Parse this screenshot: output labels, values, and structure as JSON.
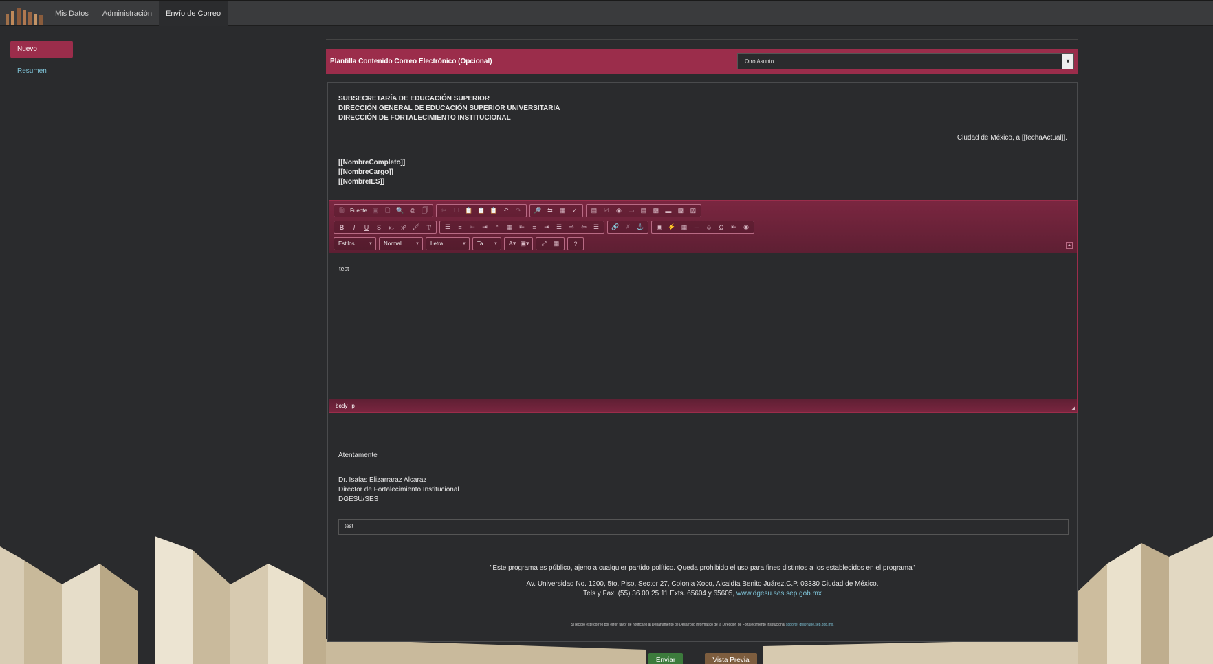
{
  "nav": {
    "items": [
      {
        "label": "Mis Datos"
      },
      {
        "label": "Administración"
      },
      {
        "label": "Envío de Correo"
      }
    ]
  },
  "sidebar": {
    "new_label": "Nuevo",
    "summary_label": "Resumen"
  },
  "template_bar": {
    "label": "Plantilla Contenido Correo Electrónico (Opcional)",
    "selected": "Otro Asunto"
  },
  "letter": {
    "header_lines": [
      "SUBSECRETARÍA DE EDUCACIÓN SUPERIOR",
      "DIRECCIÓN GENERAL DE EDUCACIÓN SUPERIOR UNIVERSITARIA",
      "DIRECCIÓN DE FORTALECIMIENTO INSTITUCIONAL"
    ],
    "date_line": "Ciudad de México, a [[fechaActual]].",
    "recipient_lines": [
      "[[NombreCompleto]]",
      "[[NombreCargo]]",
      "[[NombreIES]]"
    ],
    "closing": "Atentamente",
    "signature_lines": [
      "Dr. Isaías Elizarraraz Alcaraz",
      "Director de Fortalecimiento Institucional",
      "DGESU/SES"
    ],
    "footer_input_value": "test",
    "disclaimer": "\"Este programa es público, ajeno a cualquier partido político. Queda prohibido el uso para fines distintos a los establecidos en el programa\"",
    "address_line1": "Av. Universidad No. 1200, 5to. Piso, Sector 27, Colonia Xoco, Alcaldía Benito Juárez,C.P. 03330 Ciudad de México.",
    "address_line2": "Tels y Fax. (55) 36 00 25 11 Exts. 65604 y 65605, ",
    "website": "www.dgesu.ses.sep.gob.mx",
    "tiny_note": "Si recibió este correo por error, favor de notificarlo al Departamento de Desarrollo Informático de la Dirección de Fortalecimiento Institucional ",
    "tiny_email": "soporte_dfi@nube.sep.gob.mx."
  },
  "editor": {
    "font_button": "Fuente",
    "styles_combo": "Estilos",
    "format_combo": "Normal",
    "font_combo": "Letra",
    "size_combo": "Ta...",
    "content": "test",
    "path": [
      "body",
      "p"
    ]
  },
  "actions": {
    "send": "Enviar",
    "preview": "Vista Previa"
  },
  "colors": {
    "accent": "#9b2d4b",
    "background": "#2a2b2d",
    "link": "#7fc4d8",
    "send": "#3c7b3c",
    "preview": "#7d5d3e"
  }
}
